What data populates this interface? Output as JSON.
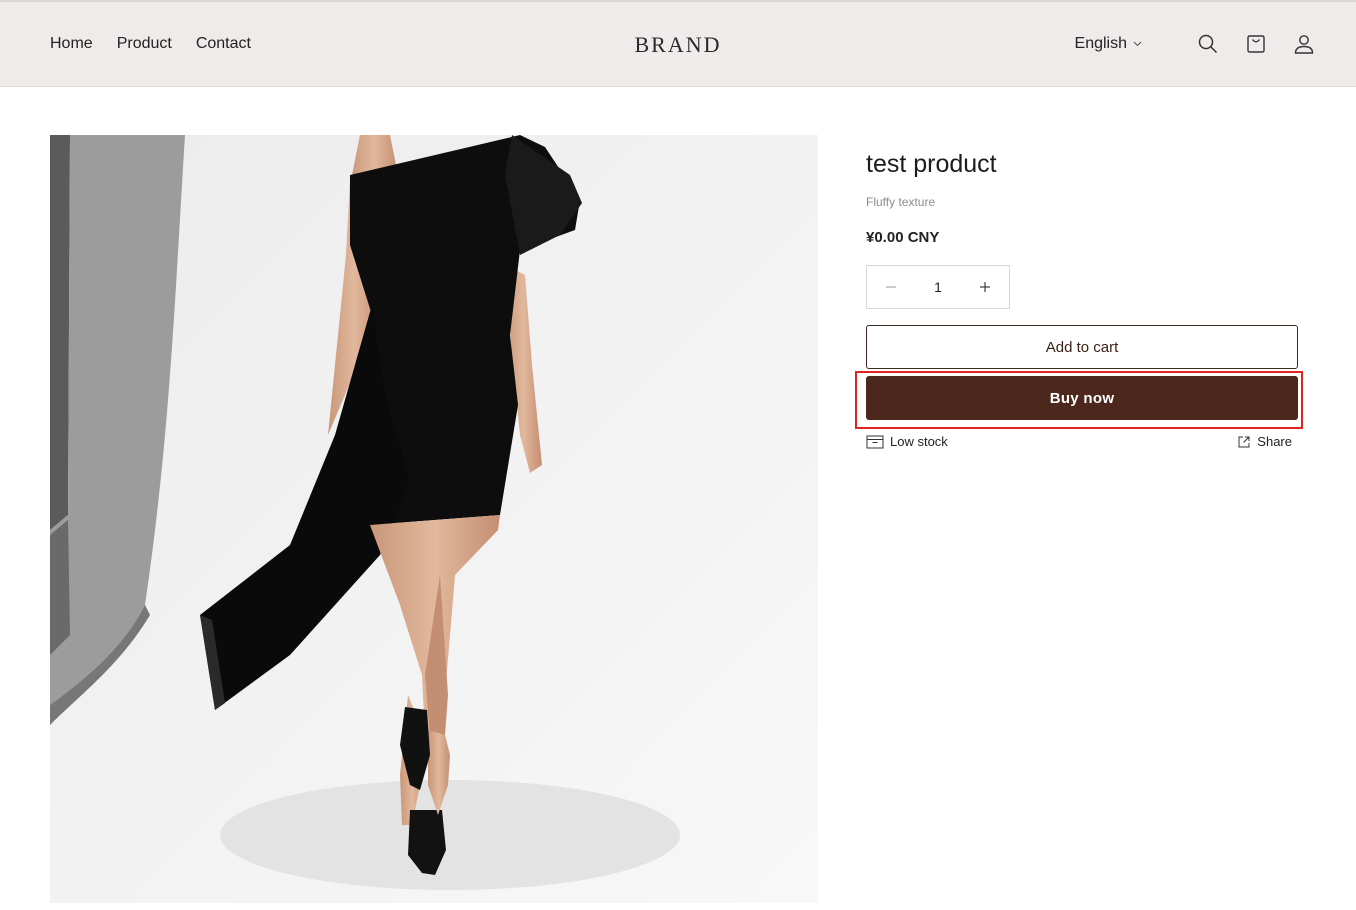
{
  "header": {
    "nav": [
      "Home",
      "Product",
      "Contact"
    ],
    "brand": "BRAND",
    "language": "English",
    "icons": [
      "search-icon",
      "cart-icon",
      "account-icon"
    ]
  },
  "product": {
    "title": "test product",
    "subtitle": "Fluffy texture",
    "price": "¥0.00 CNY",
    "quantity": "1",
    "add_to_cart_label": "Add to cart",
    "buy_now_label": "Buy now",
    "stock_label": "Low stock",
    "share_label": "Share",
    "image_name": "black-asymmetric-dress-photo"
  },
  "colors": {
    "header_bg": "#efebea",
    "accent": "#4c271b",
    "highlight": "#e02424"
  }
}
